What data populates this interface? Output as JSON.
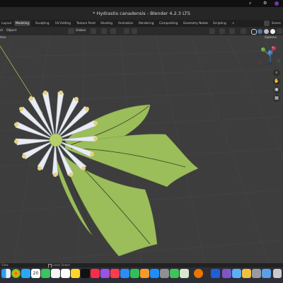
{
  "window": {
    "title": "* Hydrastis canadensis - Blender 4.2.3 LTS"
  },
  "workspace_tabs": [
    {
      "label": "Layout",
      "active": false
    },
    {
      "label": "Modeling",
      "active": true
    },
    {
      "label": "Sculpting",
      "active": false
    },
    {
      "label": "UV Editing",
      "active": false
    },
    {
      "label": "Texture Paint",
      "active": false
    },
    {
      "label": "Shading",
      "active": false
    },
    {
      "label": "Animation",
      "active": false
    },
    {
      "label": "Rendering",
      "active": false
    },
    {
      "label": "Compositing",
      "active": false
    },
    {
      "label": "Geometry Nodes",
      "active": false
    },
    {
      "label": "Scripting",
      "active": false
    }
  ],
  "add_tab_label": "+",
  "scene_label": "Scene",
  "header": {
    "left_edge": "ct",
    "object_menu": "Object",
    "transform_orientation": "Global",
    "options_label": "Options",
    "mode_label": "tion"
  },
  "gizmo": {
    "x": "X",
    "y": "Y",
    "z": "Z"
  },
  "status": {
    "left": "View",
    "middle": "Lasso Select"
  },
  "colors": {
    "viewport_bg": "#3d3d3d",
    "leaf": "#9bbd5a",
    "petal": "#e9ecf2",
    "stamen": "#e6d27a",
    "accent": "#4772b3"
  },
  "dock_icons": [
    "finder-icon",
    "launchpad-icon",
    "safari-icon",
    "messages-icon",
    "mail-icon",
    "maps-icon",
    "photos-icon",
    "facetime-icon",
    "calendar-icon",
    "contacts-icon",
    "reminders-icon",
    "notes-icon",
    "tv-icon",
    "music-icon",
    "podcasts-icon",
    "news-icon",
    "keynote-icon",
    "numbers-icon",
    "pages-icon",
    "appstore-icon",
    "settings-icon",
    "bluetooth-icon",
    "blender-icon",
    "finder2-icon",
    "preview-icon",
    "trash-icon"
  ]
}
